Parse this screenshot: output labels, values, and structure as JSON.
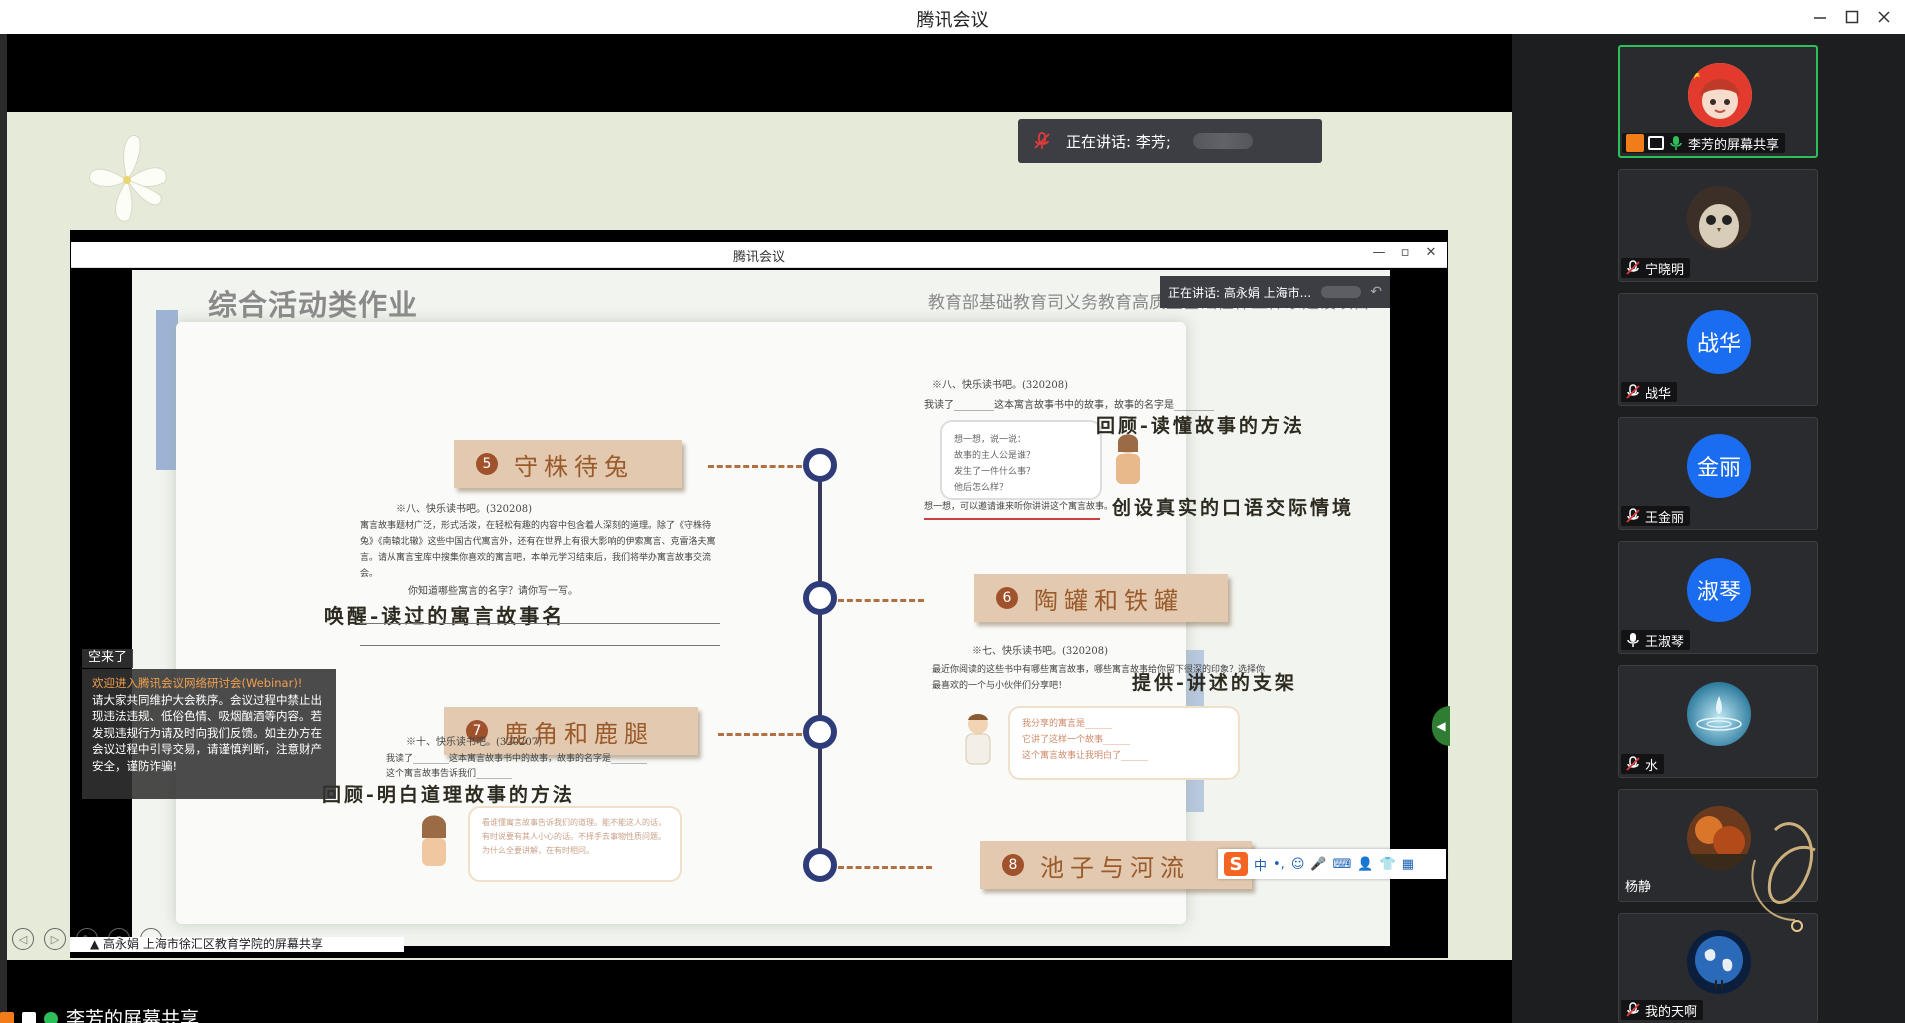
{
  "window": {
    "title": "腾讯会议"
  },
  "speaking_banner": {
    "prefix": "正在讲话: 李芳;"
  },
  "shared_screen": {
    "inner_window_title": "腾讯会议",
    "inner_speaking": "正在讲话: 高永娟 上海市...",
    "slide": {
      "heading": "综合活动类作业",
      "project": "教育部基础教育司义务教育高质量基础性作业体系建设项目",
      "tags": [
        {
          "num": "5",
          "label": "守株待兔"
        },
        {
          "num": "6",
          "label": "陶罐和铁罐"
        },
        {
          "num": "7",
          "label": "鹿角和鹿腿"
        },
        {
          "num": "8",
          "label": "池子与河流"
        }
      ],
      "handwritten": {
        "a": "回顾-读懂故事的方法",
        "b": "创设真实的口语交际情境",
        "c": "唤醒-读过的寓言故事名",
        "d": "提供-讲述的支架",
        "e": "回顾-明白道理故事的方法"
      },
      "small_text": {
        "s1": "※八、快乐读书吧。(320208)",
        "s1_body": "寓言故事题材广泛，形式活泼，在轻松有趣的内容中包含着人深刻的道理。除了《守株待兔》《南辕北辙》这些中国古代寓言外，还有在世界上有很大影响的伊索寓言、克雷洛夫寓言。请从寓言宝库中搜集你喜欢的寓言吧，本单元学习结束后，我们将举办寓言故事交流会。",
        "s1_q": "你知道哪些寓言的名字？请你写一写。",
        "s2": "※八、快乐读书吧。(320208)",
        "s2_body": "我读了________这本寓言故事书中的故事，故事的名字是________",
        "s2_note": "想一想，可以邀请谁来听你讲讲这个寓言故事。",
        "b1": [
          "想一想，说一说：",
          "故事的主人公是谁？",
          "发生了一件什么事？",
          "他后怎么样？"
        ],
        "s3": "※七、快乐读书吧。(320208)",
        "s3_body": "最近你阅读的这些书中有哪些寓言故事，哪些寓言故事给你留下很深的印象？选择你最喜欢的一个与小伙伴们分享吧！",
        "b2": [
          "我分享的寓言是______",
          "它讲了这样一个故事______",
          "这个寓言故事让我明白了______"
        ],
        "s4": "※十、快乐读书吧。(320207)",
        "s4_body": "我读了________这本寓言故事书中的故事，故事的名字是________",
        "s4_body2": "这个寓言故事告诉我们________",
        "b3": "看谁懂寓言故事告诉我们的道理。能不能这人的话，有时说要有其人小心的话。不择手去事物性质问题。为什么全要讲解，在有时相问。"
      }
    },
    "ime_toolbar": {
      "logo": "S",
      "keys": [
        "中",
        "•,",
        "☺",
        "🎤",
        "⌨",
        "👤",
        "👕",
        "▦"
      ]
    },
    "chat_overlay": {
      "tooltip": "空来了",
      "welcome": "欢迎进入腾讯会议网络研讨会(Webinar)!",
      "body": "请大家共同维护大会秩序。会议过程中禁止出现违法违规、低俗色情、吸烟酗酒等内容。若发现违规行为请及时向我们反馈。如主办方在会议过程中引导交易，请谨慎判断，注意财产安全，谨防诈骗!"
    },
    "inner_share_label": "▲ 高永娟 上海市徐汇区教育学院的屏幕共享"
  },
  "bottom_share_label": "李芳的屏幕共享",
  "participants": [
    {
      "name": "李芳的屏幕共享",
      "avatar_type": "photo-girl",
      "active": true
    },
    {
      "name": "宁晓明",
      "avatar_type": "photo-owl"
    },
    {
      "name": "战华",
      "avatar_text": "战华",
      "avatar_type": "text"
    },
    {
      "name": "王金丽",
      "avatar_text": "金丽",
      "avatar_type": "text"
    },
    {
      "name": "王淑琴",
      "avatar_text": "淑琴",
      "avatar_type": "text"
    },
    {
      "name": "水",
      "avatar_type": "photo-water"
    },
    {
      "name": "杨静",
      "avatar_type": "photo-autumn"
    },
    {
      "name": "我的天啊",
      "avatar_type": "photo-earth"
    }
  ],
  "colors": {
    "accent_green": "#2fbf5a",
    "avatar_blue": "#1a6cf0",
    "mic_red": "#e03b3b"
  }
}
